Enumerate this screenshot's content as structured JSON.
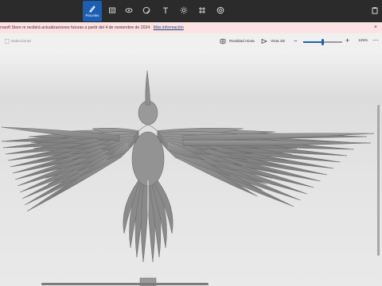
{
  "toolbar": {
    "tools": [
      {
        "name": "brushes",
        "label": "Pinceles",
        "active": true
      },
      {
        "name": "2d-shapes",
        "active": false
      },
      {
        "name": "3d-shapes",
        "active": false
      },
      {
        "name": "stickers",
        "active": false
      },
      {
        "name": "text",
        "active": false
      },
      {
        "name": "effects",
        "active": false
      },
      {
        "name": "canvas",
        "active": false
      },
      {
        "name": "3d-library",
        "active": false
      }
    ],
    "paste_icon": "paste-icon"
  },
  "notice": {
    "text": "rosoft Store ni recibirá actualizaciones futuras a partir del 4 de noviembre de 2024.",
    "link": "Más información"
  },
  "subbar": {
    "select_label": "Seleccionar",
    "mixed_reality_label": "Realidad mixta",
    "view3d_label": "Vista 3D",
    "zoom_value": "125%",
    "zoom_level_fraction": 0.5
  },
  "colors": {
    "toolbar_bg": "#2b2b2b",
    "accent": "#1a5fb4",
    "notice_bg": "#fbe3e3",
    "canvas_bg": "#e2e2e2",
    "model_gray": "#8f8f8f"
  }
}
